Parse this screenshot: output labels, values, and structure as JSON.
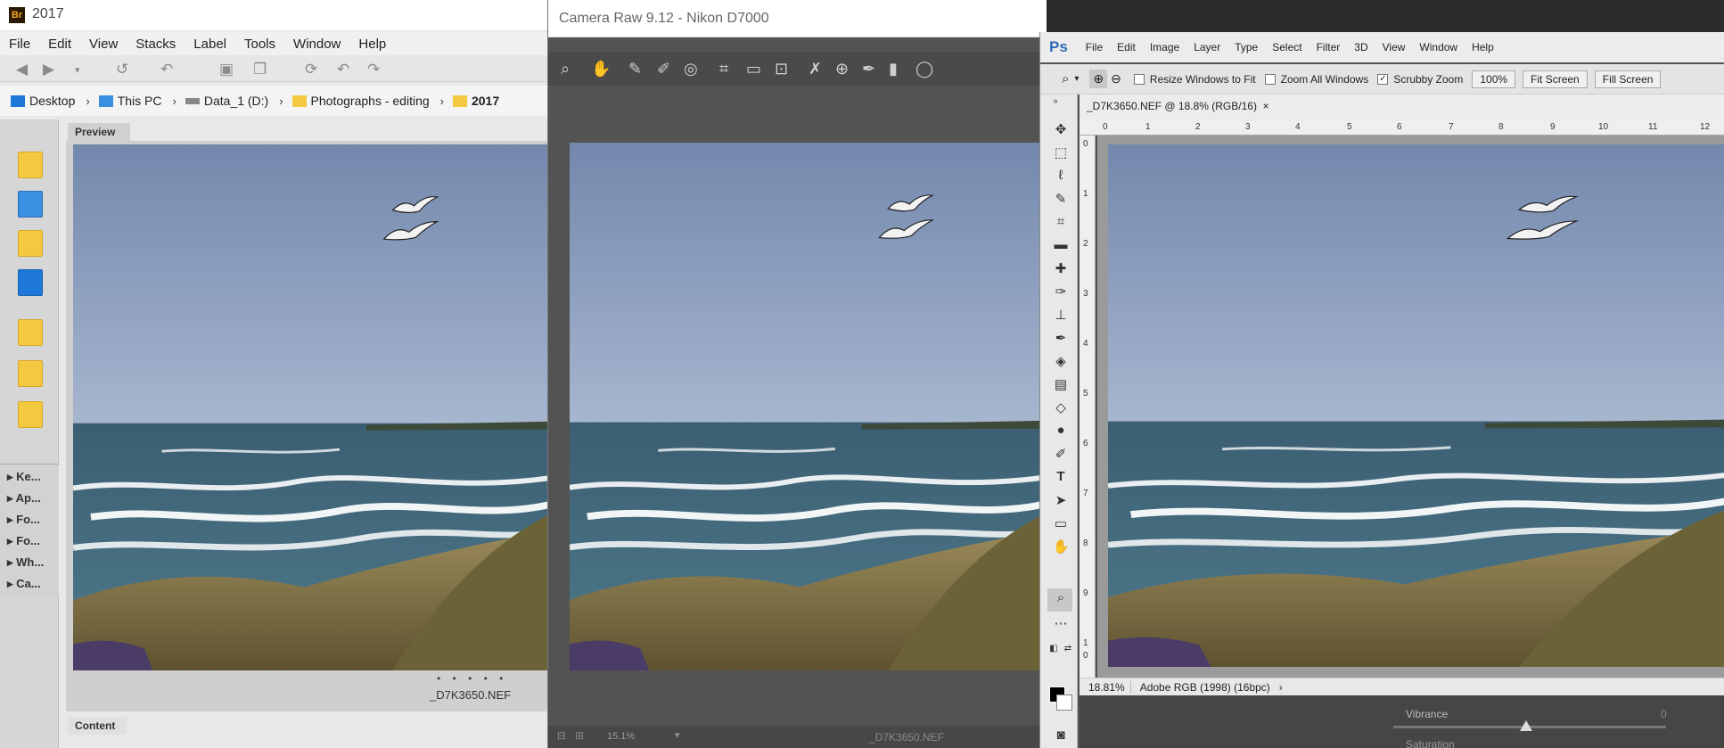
{
  "bridge": {
    "app_icon": "Br",
    "title": "2017",
    "menu": [
      "File",
      "Edit",
      "View",
      "Stacks",
      "Label",
      "Tools",
      "Window",
      "Help"
    ],
    "path": [
      "Desktop",
      "This PC",
      "Data_1 (D:)",
      "Photographs - editing",
      "2017"
    ],
    "left_panels": [
      "Ke...",
      "Ap...",
      "Fo...",
      "Fo...",
      "Wh...",
      "Ca..."
    ],
    "preview_tab": "Preview",
    "content_tab": "Content",
    "filename": "_D7K3650.NEF",
    "dots": "• • • • •"
  },
  "camera_raw": {
    "title": "Camera Raw 9.12  -  Nikon D7000",
    "zoom": "15.1%",
    "filename": "_D7K3650.NEF"
  },
  "photoshop": {
    "logo": "Ps",
    "menu": [
      "File",
      "Edit",
      "Image",
      "Layer",
      "Type",
      "Select",
      "Filter",
      "3D",
      "View",
      "Window",
      "Help"
    ],
    "options": {
      "resize_windows": "Resize Windows to Fit",
      "zoom_all": "Zoom All Windows",
      "scrubby": "Scrubby Zoom",
      "btn_100": "100%",
      "fit_screen": "Fit Screen",
      "fill_screen": "Fill Screen"
    },
    "doc_tab": "_D7K3650.NEF @ 18.8% (RGB/16)",
    "doc_tab_close": "×",
    "ruler_top": [
      "0",
      "1",
      "2",
      "3",
      "4",
      "5",
      "6",
      "7",
      "8",
      "9",
      "10",
      "11",
      "12"
    ],
    "ruler_left": [
      "0",
      "1",
      "2",
      "3",
      "4",
      "5",
      "6",
      "7",
      "8",
      "9",
      "1",
      "0"
    ],
    "status_zoom": "18.81%",
    "status_profile": "Adobe RGB (1998) (16bpc)",
    "status_arrow": "›",
    "acr_panel": {
      "vibrance_label": "Vibrance",
      "vibrance_value": 0,
      "saturation_label": "Saturation"
    }
  },
  "colors": {
    "sky": "#7f95b8",
    "sea": "#3f6579",
    "grass": "#8b7b4a",
    "ps_blue": "#2f6db5"
  }
}
